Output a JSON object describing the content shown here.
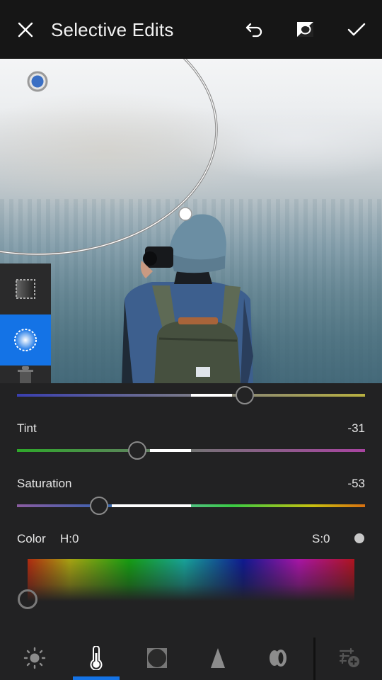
{
  "header": {
    "title": "Selective Edits",
    "close_icon": "close-icon",
    "undo_icon": "undo-icon",
    "before_after_icon": "before-after-toggle-icon",
    "confirm_icon": "checkmark-icon"
  },
  "photo": {
    "description": "Person in beanie with backpack photographing misty forest",
    "pin_color": "#3a6fc4"
  },
  "tools": [
    {
      "name": "linear-gradient-tool",
      "active": false
    },
    {
      "name": "radial-gradient-tool",
      "active": true
    },
    {
      "name": "delete-tool",
      "active": false
    }
  ],
  "sliders": {
    "temp": {
      "label": "",
      "value": 31,
      "range": [
        -100,
        100
      ],
      "gradient": [
        "#3a3fb0",
        "#7a7a88",
        "#b8b040"
      ]
    },
    "tint": {
      "label": "Tint",
      "value": -31,
      "value_text": "-31",
      "range": [
        -100,
        100
      ],
      "gradient": [
        "#2ea82a",
        "#7a6e7a",
        "#a844a0"
      ]
    },
    "saturation": {
      "label": "Saturation",
      "value": -53,
      "value_text": "-53",
      "range": [
        -100,
        100
      ],
      "gradient": [
        "#8a5ca0",
        "#3a62b0",
        "#3acb44",
        "#c8c010",
        "#d87010"
      ]
    }
  },
  "color": {
    "label": "Color",
    "hue_text": "H:0",
    "sat_text": "S:0",
    "swatch_color": "#c8c8c8"
  },
  "bottom_tabs": [
    {
      "name": "light-icon",
      "active": false
    },
    {
      "name": "color-temperature-icon",
      "active": true
    },
    {
      "name": "effects-icon",
      "active": false
    },
    {
      "name": "detail-icon",
      "active": false
    },
    {
      "name": "optics-icon",
      "active": false
    },
    {
      "name": "add-adjustment-icon",
      "active": false
    }
  ],
  "accent": "#1473e6"
}
